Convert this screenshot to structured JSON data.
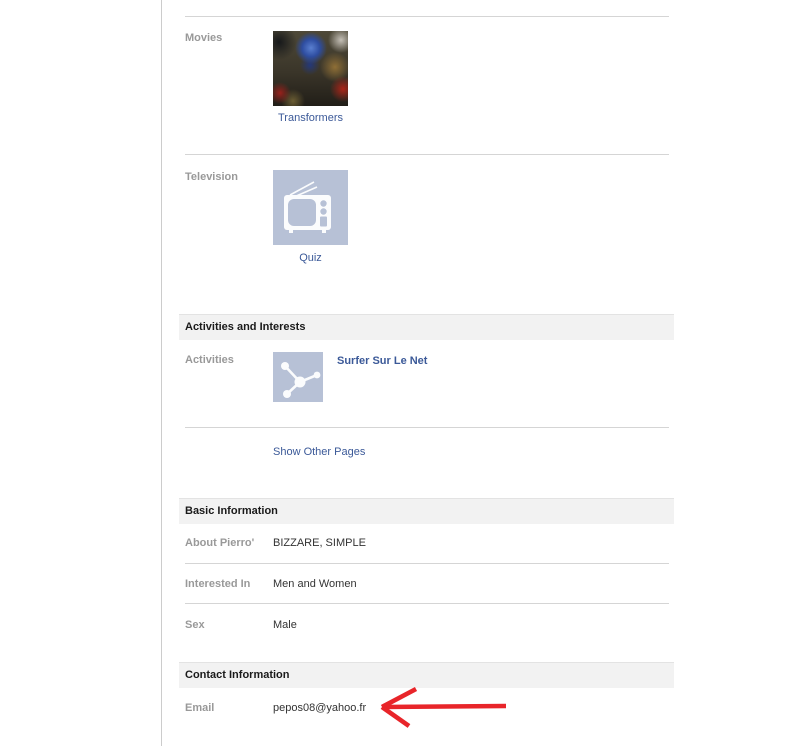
{
  "theme": {
    "link_color": "#3b5998",
    "label_color": "#999999",
    "value_color": "#333333",
    "section_bar_bg": "#f2f2f2",
    "divider_color": "#d5d5d5",
    "placeholder_bg": "#b7c1d6",
    "arrow_color": "#e8252a"
  },
  "sections": {
    "movies": {
      "label": "Movies",
      "item": {
        "title": "Transformers",
        "thumbnail_icon": "transformers-poster-image"
      }
    },
    "television": {
      "label": "Television",
      "item": {
        "title": "Quiz",
        "thumbnail_icon": "tv-icon"
      }
    },
    "activities_interests": {
      "header": "Activities and Interests",
      "activities_label": "Activities",
      "item": {
        "title": "Surfer Sur Le Net",
        "thumbnail_icon": "molecule-icon"
      },
      "show_other_pages": "Show Other Pages"
    },
    "basic_info": {
      "header": "Basic Information",
      "rows": [
        {
          "label": "About Pierro'",
          "value": "BIZZARE, SIMPLE"
        },
        {
          "label": "Interested In",
          "value": "Men and Women"
        },
        {
          "label": "Sex",
          "value": "Male"
        }
      ]
    },
    "contact_info": {
      "header": "Contact Information",
      "rows": [
        {
          "label": "Email",
          "value": "pepos08@yahoo.fr"
        }
      ]
    }
  },
  "annotation": {
    "red_arrow_points_at": "email-value"
  }
}
